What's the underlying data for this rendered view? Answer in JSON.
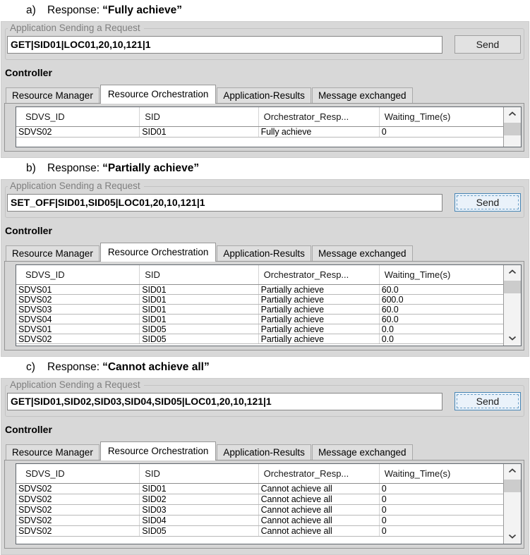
{
  "colors": {
    "panel_background": "#d8d8d8",
    "focused_button_border": "#4886b5",
    "focused_button_background": "#eaf2fa"
  },
  "figure": {
    "panels": [
      {
        "label": "a)",
        "caption": "Response:",
        "response": "“Fully achieve”",
        "group_title": "Application Sending a Request",
        "request": "GET|SID01|LOC01,20,10,121|1",
        "send": "Send",
        "controller": "Controller",
        "tabs": [
          {
            "label": "Resource Manager",
            "selected": false
          },
          {
            "label": "Resource Orchestration",
            "selected": true
          },
          {
            "label": "Application-Results",
            "selected": false
          },
          {
            "label": "Message exchanged",
            "selected": false
          }
        ],
        "columns": [
          "SDVS_ID",
          "SID",
          "Orchestrator_Resp...",
          "Waiting_Time(s)"
        ],
        "rows": [
          [
            "SDVS02",
            "SID01",
            "Fully achieve",
            "0"
          ]
        ]
      },
      {
        "label": "b)",
        "caption": "Response:",
        "response": "“Partially achieve”",
        "group_title": "Application Sending a Request",
        "request": "SET_OFF|SID01,SID05|LOC01,20,10,121|1",
        "send": "Send",
        "controller": "Controller",
        "tabs": [
          {
            "label": "Resource Manager",
            "selected": false
          },
          {
            "label": "Resource Orchestration",
            "selected": true
          },
          {
            "label": "Application-Results",
            "selected": false
          },
          {
            "label": "Message exchanged",
            "selected": false
          }
        ],
        "columns": [
          "SDVS_ID",
          "SID",
          "Orchestrator_Resp...",
          "Waiting_Time(s)"
        ],
        "rows": [
          [
            "SDVS01",
            "SID01",
            "Partially achieve",
            "60.0"
          ],
          [
            "SDVS02",
            "SID01",
            "Partially achieve",
            "600.0"
          ],
          [
            "SDVS03",
            "SID01",
            "Partially achieve",
            "60.0"
          ],
          [
            "SDVS04",
            "SID01",
            "Partially achieve",
            "60.0"
          ],
          [
            "SDVS01",
            "SID05",
            "Partially achieve",
            "0.0"
          ],
          [
            "SDVS02",
            "SID05",
            "Partially achieve",
            "0.0"
          ]
        ]
      },
      {
        "label": "c)",
        "caption": "Response:",
        "response": "“Cannot achieve all”",
        "group_title": "Application Sending a Request",
        "request": "GET|SID01,SID02,SID03,SID04,SID05|LOC01,20,10,121|1",
        "send": "Send",
        "controller": "Controller",
        "tabs": [
          {
            "label": "Resource Manager",
            "selected": false
          },
          {
            "label": "Resource Orchestration",
            "selected": true
          },
          {
            "label": "Application-Results",
            "selected": false
          },
          {
            "label": "Message exchanged",
            "selected": false
          }
        ],
        "columns": [
          "SDVS_ID",
          "SID",
          "Orchestrator_Resp...",
          "Waiting_Time(s)"
        ],
        "rows": [
          [
            "SDVS02",
            "SID01",
            "Cannot achieve all",
            "0"
          ],
          [
            "SDVS02",
            "SID02",
            "Cannot achieve all",
            "0"
          ],
          [
            "SDVS02",
            "SID03",
            "Cannot achieve all",
            "0"
          ],
          [
            "SDVS02",
            "SID04",
            "Cannot achieve all",
            "0"
          ],
          [
            "SDVS02",
            "SID05",
            "Cannot achieve all",
            "0"
          ]
        ]
      }
    ]
  }
}
